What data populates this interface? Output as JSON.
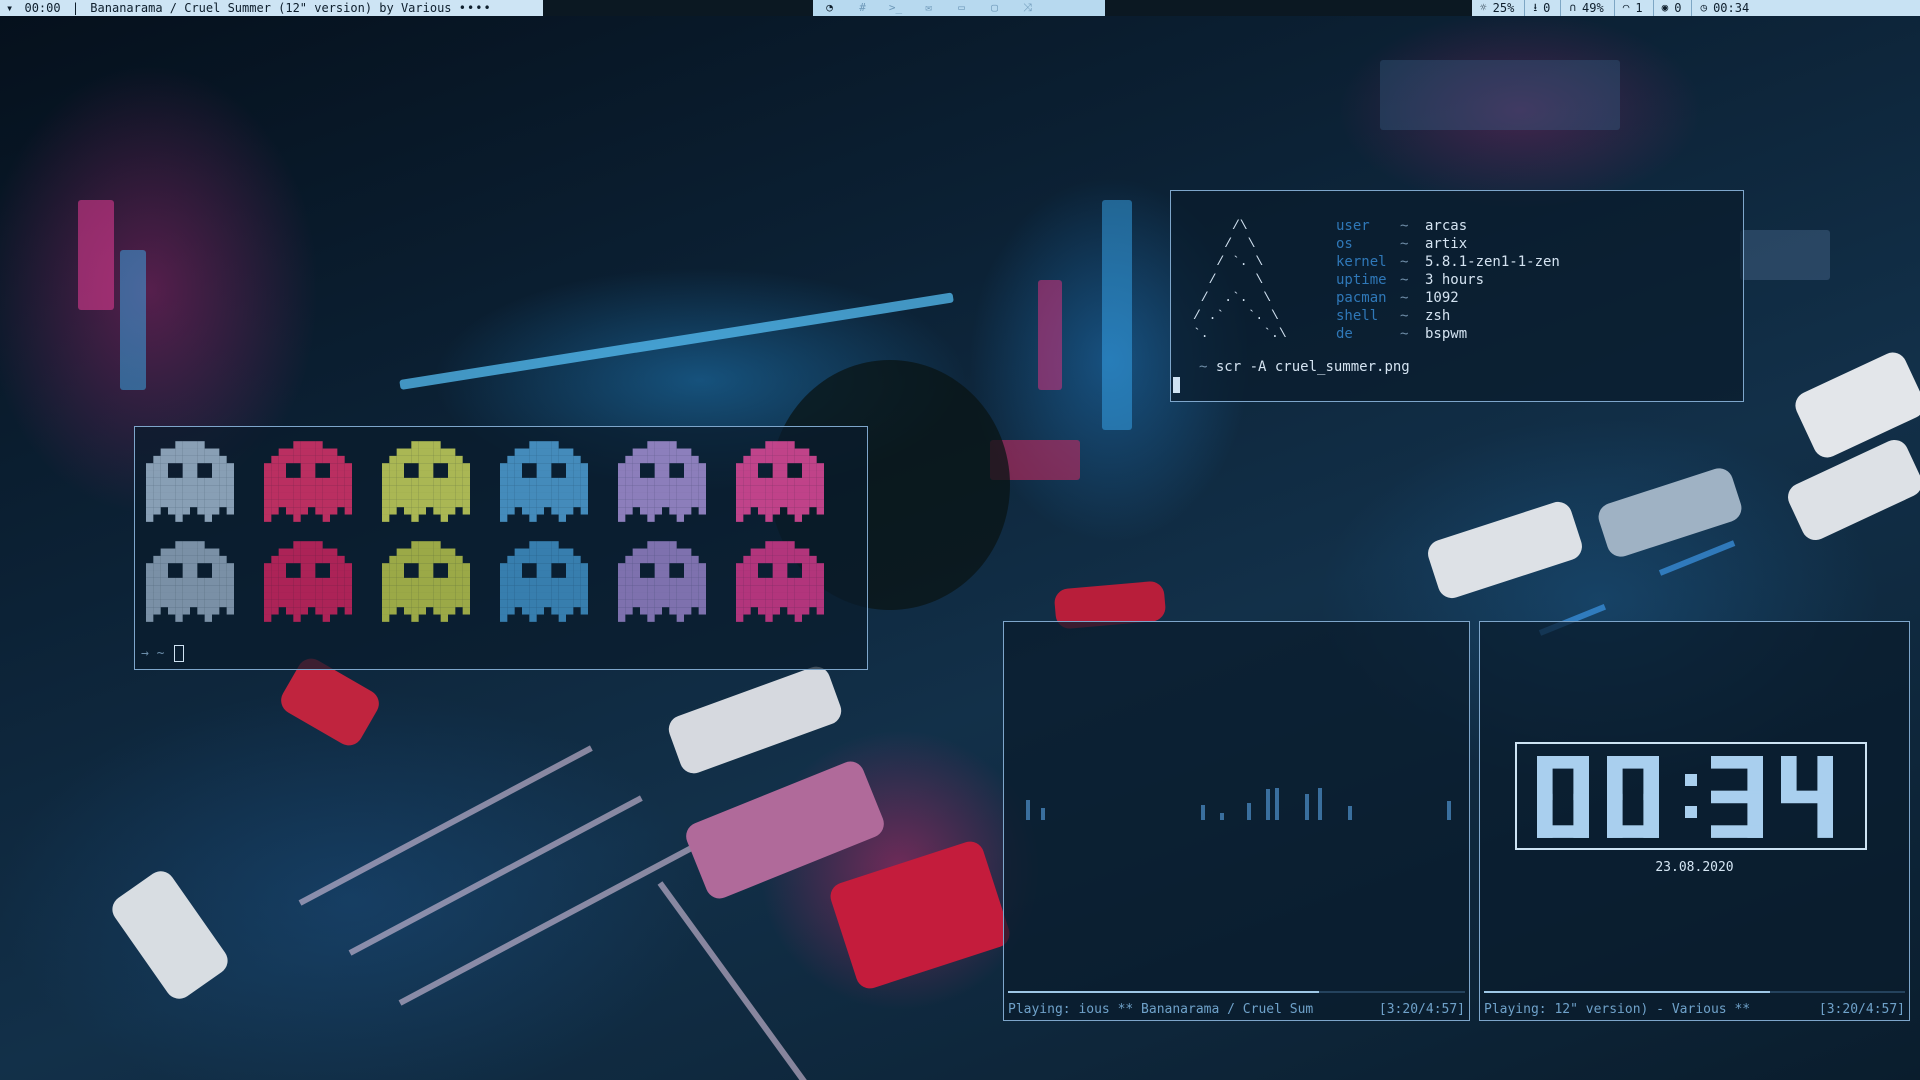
{
  "topbar": {
    "menu_icon": "chevron-down-icon",
    "time_left": "00:00",
    "track_title": "Bananarama / Cruel Summer (12\" version) by Various",
    "track_dots": "••••",
    "workspaces": [
      {
        "icon": "terminal-swirl-icon",
        "glyph": "◔",
        "active": true
      },
      {
        "icon": "hash-icon",
        "glyph": "#",
        "active": false
      },
      {
        "icon": "shell-prompt-icon",
        "glyph": ">_",
        "active": false
      },
      {
        "icon": "mail-icon",
        "glyph": "✉",
        "active": false
      },
      {
        "icon": "monitor-icon",
        "glyph": "▭",
        "active": false
      },
      {
        "icon": "window-icon",
        "glyph": "▢",
        "active": false
      },
      {
        "icon": "shuffle-icon",
        "glyph": "⤨",
        "active": false
      }
    ],
    "stats": [
      {
        "name": "cpu",
        "icon": "brightness-icon",
        "glyph": "☼",
        "value": "25%"
      },
      {
        "name": "downloads",
        "icon": "download-icon",
        "glyph": "⭳",
        "value": "0"
      },
      {
        "name": "volume",
        "icon": "headphones-icon",
        "glyph": "∩",
        "value": "49%"
      },
      {
        "name": "wifi",
        "icon": "wifi-icon",
        "glyph": "◠",
        "value": "1"
      },
      {
        "name": "updates",
        "icon": "package-icon",
        "glyph": "◉",
        "value": "0"
      },
      {
        "name": "clock",
        "icon": "clock-icon",
        "glyph": "◷",
        "value": "00:34"
      }
    ]
  },
  "fetch": {
    "art": "     /\\\n    /  \\\n   / `. \\\n  /     \\\n /  .`.  \\\n/ .`   `. \\\n`.       `.\\",
    "rows": [
      {
        "key": "user",
        "value": "arcas"
      },
      {
        "key": "os",
        "value": "artix"
      },
      {
        "key": "kernel",
        "value": "5.8.1-zen1-1-zen"
      },
      {
        "key": "uptime",
        "value": "3 hours"
      },
      {
        "key": "pacman",
        "value": "1092"
      },
      {
        "key": "shell",
        "value": "zsh"
      },
      {
        "key": "de",
        "value": "bspwm"
      }
    ],
    "separator": "~",
    "prompt_symbol": "~",
    "command": "scr -A cruel_summer.png"
  },
  "ghosts": {
    "colors_top": [
      "#9fb6cc",
      "#d9326a",
      "#c7d25a",
      "#4f9fd4",
      "#a38fd4",
      "#e04a9a"
    ],
    "colors_bottom": [
      "#8ea5bb",
      "#c9245e",
      "#b5c24b",
      "#3f8fc4",
      "#9380c4",
      "#d03a8a"
    ],
    "prompt_arrow": "→",
    "prompt_symbol": "~"
  },
  "visualizer": {
    "bars": [
      {
        "pos": 0.048,
        "h": 0.6
      },
      {
        "pos": 0.08,
        "h": 0.35
      },
      {
        "pos": 0.43,
        "h": 0.45
      },
      {
        "pos": 0.47,
        "h": 0.2
      },
      {
        "pos": 0.53,
        "h": 0.5
      },
      {
        "pos": 0.57,
        "h": 0.9
      },
      {
        "pos": 0.59,
        "h": 0.95
      },
      {
        "pos": 0.655,
        "h": 0.75
      },
      {
        "pos": 0.685,
        "h": 0.95
      },
      {
        "pos": 0.75,
        "h": 0.4
      },
      {
        "pos": 0.965,
        "h": 0.55
      }
    ],
    "progress": 0.68,
    "status_left": "Playing: ious ** Bananarama / Cruel Sum",
    "status_time": "[3:20/4:57]"
  },
  "clock": {
    "time": "00:34",
    "date": "23.08.2020",
    "progress": 0.68,
    "status_left": "Playing: 12\" version) - Various **",
    "status_time": "[3:20/4:57]"
  },
  "colors": {
    "bar_bg": "#b0d4ec",
    "accent": "#7ea6cb",
    "key_blue": "#2f78b8"
  }
}
